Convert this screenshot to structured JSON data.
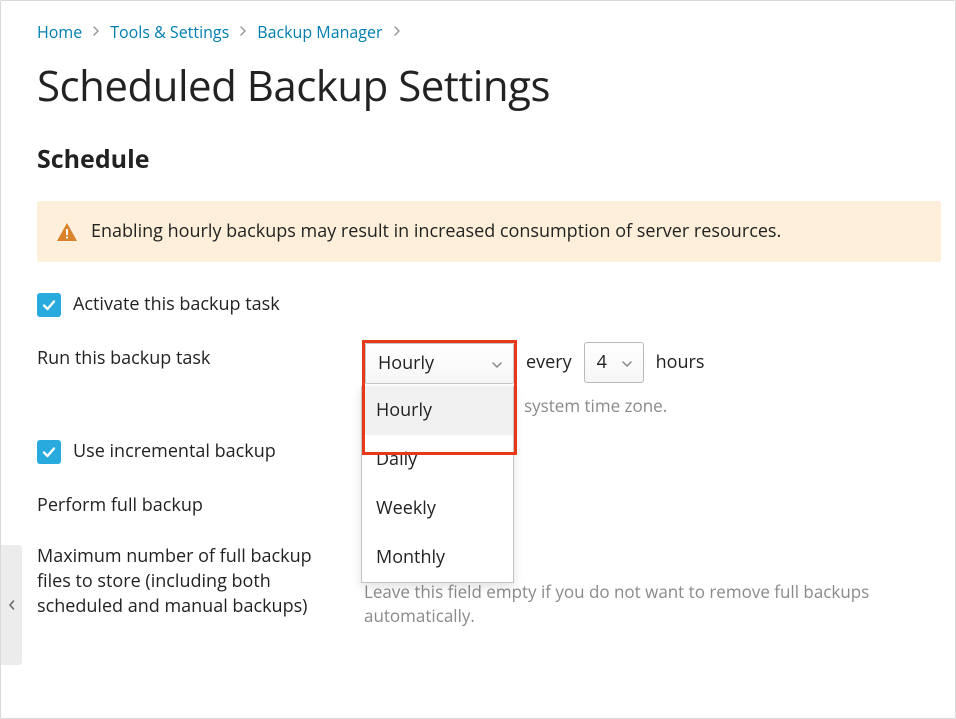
{
  "breadcrumb": {
    "items": [
      "Home",
      "Tools & Settings",
      "Backup Manager"
    ]
  },
  "page": {
    "title": "Scheduled Backup Settings",
    "section": "Schedule"
  },
  "alert": {
    "text": "Enabling hourly backups may result in increased consumption of server resources."
  },
  "activate": {
    "label": "Activate this backup task",
    "checked": true
  },
  "run_task": {
    "label": "Run this backup task",
    "frequency_selected": "Hourly",
    "frequency_options": [
      "Hourly",
      "Daily",
      "Weekly",
      "Monthly"
    ],
    "every_prefix": "every",
    "every_value": "4",
    "every_suffix": "hours",
    "hint_suffix": "system time zone."
  },
  "incremental": {
    "label": "Use incremental backup",
    "checked": true
  },
  "full_backup": {
    "label": "Perform full backup"
  },
  "max_files": {
    "label": "Maximum number of full backup files to store (including both scheduled and manual backups)",
    "hint": "Leave this field empty if you do not want to remove full backups automatically."
  }
}
